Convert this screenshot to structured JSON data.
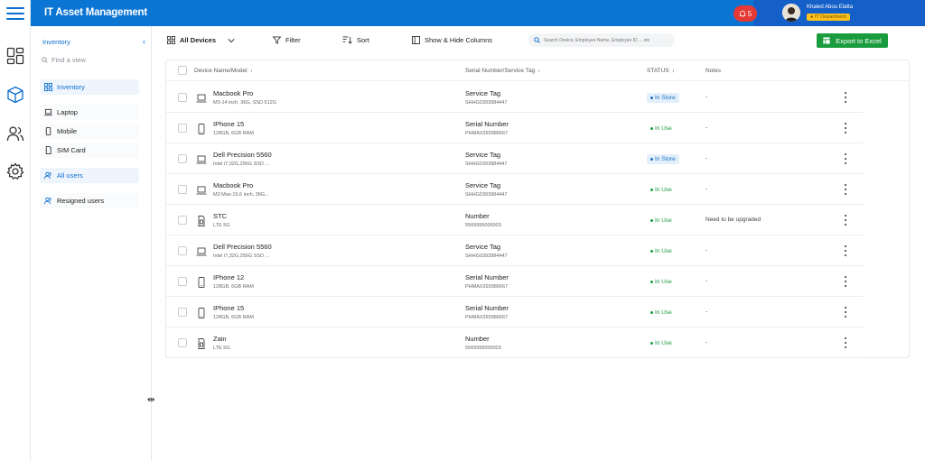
{
  "app": {
    "title": "IT Asset Management"
  },
  "header": {
    "notifications_count": "5",
    "user_name": "Khaled Abou Elatta",
    "department": "IT Department"
  },
  "sidebar": {
    "heading": "Inventory",
    "find_placeholder": "Find a view",
    "items": [
      {
        "label": "Inventory",
        "icon": "grid-icon",
        "active": true
      },
      {
        "label": "Laptop",
        "icon": "laptop-icon"
      },
      {
        "label": "Mobile",
        "icon": "mobile-icon"
      },
      {
        "label": "SIM Card",
        "icon": "sim-icon"
      },
      {
        "label": "All users",
        "icon": "users-icon",
        "active": true
      },
      {
        "label": "Resigned users",
        "icon": "users-icon"
      }
    ]
  },
  "toolbar": {
    "view": "All Devices",
    "filter": "Filter",
    "sort": "Sort",
    "columns": "Show & Hide Columns",
    "search_placeholder": "Search Device, Employee Name, Employee ID ... etc",
    "export": "Export to Excel"
  },
  "table": {
    "headers": {
      "device": "Device Name/Model",
      "serial": "Serial Number/Service Tag",
      "status": "STATUS",
      "notes": "Notes"
    },
    "rows": [
      {
        "name": "Macbook Pro",
        "spec": "M3-14 inch, 36G, SSD 512G",
        "icon": "laptop-icon",
        "serial_label": "Service Tag",
        "serial": "SHHG0393984447",
        "status": "In Store",
        "status_kind": "store",
        "note": "-"
      },
      {
        "name": "IPhone 15",
        "spec": "128GB, 6GB RAM",
        "icon": "mobile-icon",
        "serial_label": "Serial Number",
        "serial": "PHMAX393986667",
        "status": "In Use",
        "status_kind": "use",
        "note": "-"
      },
      {
        "name": "Dell Precision 5560",
        "spec": "Intel i7,32G,256G SSD ...",
        "icon": "laptop-icon",
        "serial_label": "Service Tag",
        "serial": "SHHG0393984447",
        "status": "In Store",
        "status_kind": "store",
        "note": "-"
      },
      {
        "name": "Macbook Pro",
        "spec": "M3 Max-15.6 inch, 36G...",
        "icon": "laptop-icon",
        "serial_label": "Service Tag",
        "serial": "SHHG0393984447",
        "status": "In Use",
        "status_kind": "use",
        "note": "-"
      },
      {
        "name": "STC",
        "spec": "LTE 5G",
        "icon": "sim-icon",
        "serial_label": "Number",
        "serial": "5569995000003",
        "status": "In Use",
        "status_kind": "use",
        "note": "Need to be upgraded"
      },
      {
        "name": "Dell Precision 5560",
        "spec": "Intel i7,32G,256G SSD ...",
        "icon": "laptop-icon",
        "serial_label": "Service Tag",
        "serial": "SHHG0393984447",
        "status": "In Use",
        "status_kind": "use",
        "note": "-"
      },
      {
        "name": "IPhone 12",
        "spec": "128GB, 6GB RAM",
        "icon": "mobile-icon",
        "serial_label": "Serial Number",
        "serial": "PHMAX393986667",
        "status": "In Use",
        "status_kind": "use",
        "note": "-"
      },
      {
        "name": "IPhone 15",
        "spec": "128GB, 6GB RAM",
        "icon": "mobile-icon",
        "serial_label": "Serial Number",
        "serial": "PHMAX393986667",
        "status": "In Use",
        "status_kind": "use",
        "note": "-"
      },
      {
        "name": "Zain",
        "spec": "LTE 5G",
        "icon": "sim-icon",
        "serial_label": "Number",
        "serial": "5569995000003",
        "status": "In Use",
        "status_kind": "use",
        "note": "-"
      }
    ]
  },
  "colors": {
    "brand_blue": "#0b75d4",
    "accent_green": "#1a9c3e",
    "alert_red": "#e53935",
    "dept_yellow": "#ffc21a"
  }
}
